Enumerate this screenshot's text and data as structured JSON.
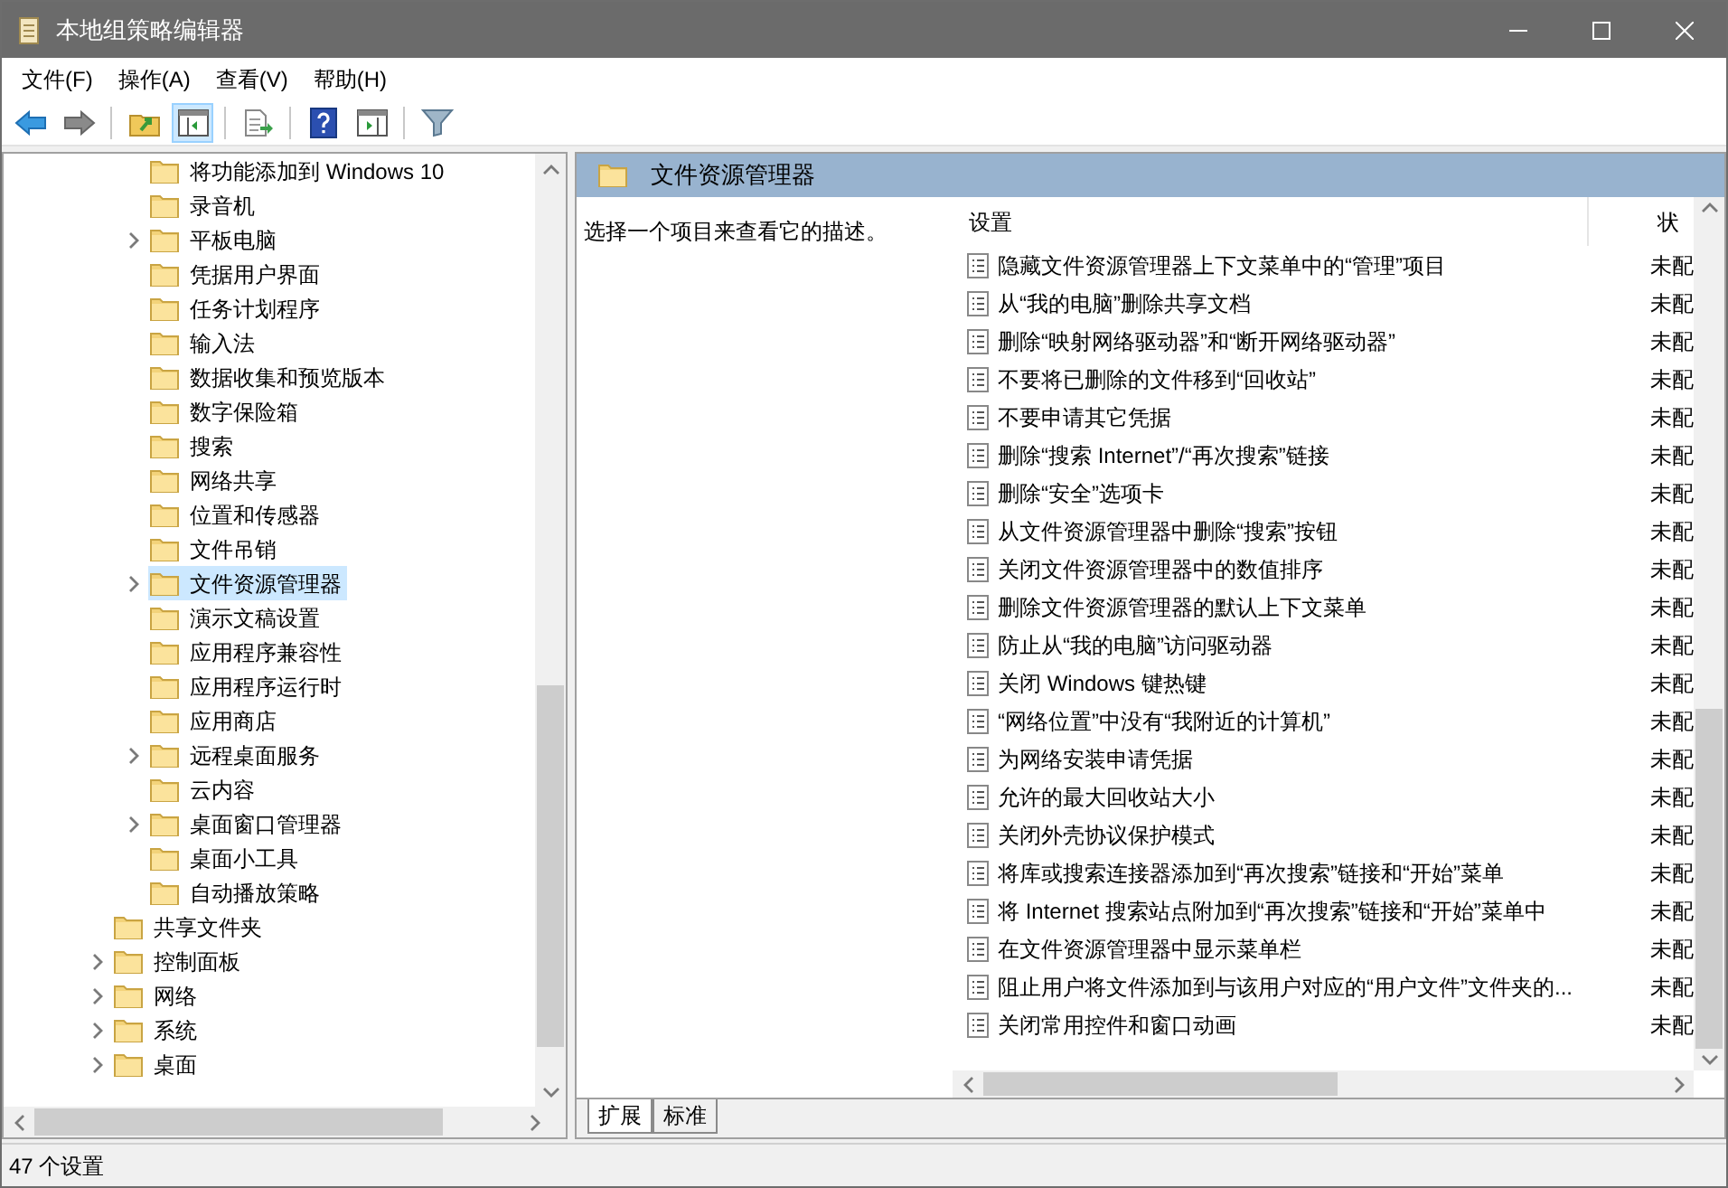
{
  "window": {
    "title": "本地组策略编辑器"
  },
  "menu": [
    "文件(F)",
    "操作(A)",
    "查看(V)",
    "帮助(H)"
  ],
  "toolbar": [
    {
      "kind": "back",
      "pressed": false
    },
    {
      "kind": "forward",
      "pressed": false
    },
    {
      "kind": "sep"
    },
    {
      "kind": "up",
      "pressed": false
    },
    {
      "kind": "tree",
      "pressed": true
    },
    {
      "kind": "sep"
    },
    {
      "kind": "export",
      "pressed": false
    },
    {
      "kind": "sep"
    },
    {
      "kind": "help",
      "pressed": false
    },
    {
      "kind": "pane",
      "pressed": false
    },
    {
      "kind": "sep"
    },
    {
      "kind": "filter",
      "pressed": false
    }
  ],
  "tree": [
    {
      "children": [
        {
          "label": "将功能添加到 Windows 10",
          "has_children": false,
          "selected": false
        },
        {
          "label": "录音机",
          "has_children": false,
          "selected": false
        },
        {
          "label": "平板电脑",
          "has_children": true,
          "selected": false
        },
        {
          "label": "凭据用户界面",
          "has_children": false,
          "selected": false
        },
        {
          "label": "任务计划程序",
          "has_children": false,
          "selected": false
        },
        {
          "label": "输入法",
          "has_children": false,
          "selected": false
        },
        {
          "label": "数据收集和预览版本",
          "has_children": false,
          "selected": false
        },
        {
          "label": "数字保险箱",
          "has_children": false,
          "selected": false
        },
        {
          "label": "搜索",
          "has_children": false,
          "selected": false
        },
        {
          "label": "网络共享",
          "has_children": false,
          "selected": false
        },
        {
          "label": "位置和传感器",
          "has_children": false,
          "selected": false
        },
        {
          "label": "文件吊销",
          "has_children": false,
          "selected": false
        },
        {
          "label": "文件资源管理器",
          "has_children": true,
          "selected": true
        },
        {
          "label": "演示文稿设置",
          "has_children": false,
          "selected": false
        },
        {
          "label": "应用程序兼容性",
          "has_children": false,
          "selected": false
        },
        {
          "label": "应用程序运行时",
          "has_children": false,
          "selected": false
        },
        {
          "label": "应用商店",
          "has_children": false,
          "selected": false
        },
        {
          "label": "远程桌面服务",
          "has_children": true,
          "selected": false
        },
        {
          "label": "云内容",
          "has_children": false,
          "selected": false
        },
        {
          "label": "桌面窗口管理器",
          "has_children": true,
          "selected": false
        },
        {
          "label": "桌面小工具",
          "has_children": false,
          "selected": false
        },
        {
          "label": "自动播放策略",
          "has_children": false,
          "selected": false
        }
      ]
    },
    {
      "label": "共享文件夹",
      "has_children": false,
      "selected": false
    },
    {
      "label": "控制面板",
      "has_children": true,
      "selected": false
    },
    {
      "label": "网络",
      "has_children": true,
      "selected": false
    },
    {
      "label": "系统",
      "has_children": true,
      "selected": false
    },
    {
      "label": "桌面",
      "has_children": true,
      "selected": false
    }
  ],
  "details": {
    "title": "文件资源管理器",
    "description": "选择一个项目来查看它的描述。",
    "columns": [
      "设置",
      "状"
    ],
    "rows": [
      {
        "name": "隐藏文件资源管理器上下文菜单中的“管理”项目",
        "state": "未配"
      },
      {
        "name": "从“我的电脑”删除共享文档",
        "state": "未配"
      },
      {
        "name": "删除“映射网络驱动器”和“断开网络驱动器”",
        "state": "未配"
      },
      {
        "name": "不要将已删除的文件移到“回收站”",
        "state": "未配"
      },
      {
        "name": "不要申请其它凭据",
        "state": "未配"
      },
      {
        "name": "删除“搜索 Internet”/“再次搜索”链接",
        "state": "未配"
      },
      {
        "name": "删除“安全”选项卡",
        "state": "未配"
      },
      {
        "name": "从文件资源管理器中删除“搜索”按钮",
        "state": "未配"
      },
      {
        "name": "关闭文件资源管理器中的数值排序",
        "state": "未配"
      },
      {
        "name": "删除文件资源管理器的默认上下文菜单",
        "state": "未配"
      },
      {
        "name": "防止从“我的电脑”访问驱动器",
        "state": "未配"
      },
      {
        "name": "关闭 Windows 键热键",
        "state": "未配"
      },
      {
        "name": "“网络位置”中没有“我附近的计算机”",
        "state": "未配"
      },
      {
        "name": "为网络安装申请凭据",
        "state": "未配"
      },
      {
        "name": "允许的最大回收站大小",
        "state": "未配"
      },
      {
        "name": "关闭外壳协议保护模式",
        "state": "未配"
      },
      {
        "name": "将库或搜索连接器添加到“再次搜索”链接和“开始”菜单",
        "state": "未配"
      },
      {
        "name": "将 Internet 搜索站点附加到“再次搜索”链接和“开始”菜单中",
        "state": "未配"
      },
      {
        "name": "在文件资源管理器中显示菜单栏",
        "state": "未配"
      },
      {
        "name": "阻止用户将文件添加到与该用户对应的“用户文件”文件夹的...",
        "state": "未配"
      },
      {
        "name": "关闭常用控件和窗口动画",
        "state": "未配"
      }
    ]
  },
  "tabs": [
    {
      "label": "扩展",
      "selected": true
    },
    {
      "label": "标准",
      "selected": false
    }
  ],
  "status_bar": "47 个设置"
}
